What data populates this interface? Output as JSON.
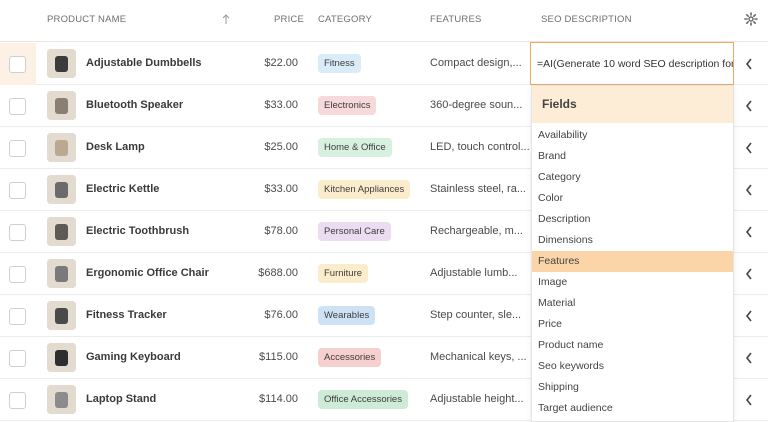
{
  "header": {
    "product_name": "PRODUCT NAME",
    "price": "PRICE",
    "category": "CATEGORY",
    "features": "FEATURES",
    "seo": "SEO DESCRIPTION",
    "sort_icon": "arrow-up-icon",
    "settings_icon": "gear-icon"
  },
  "rows": [
    {
      "name": "Adjustable Dumbbells",
      "price": "$22.00",
      "category": "Fitness",
      "cat_bg": "#d9ecf7",
      "features": "Compact design,..."
    },
    {
      "name": "Bluetooth Speaker",
      "price": "$33.00",
      "category": "Electronics",
      "cat_bg": "#f8d9d9",
      "features": "360-degree soun..."
    },
    {
      "name": "Desk Lamp",
      "price": "$25.00",
      "category": "Home & Office",
      "cat_bg": "#d8f0e0",
      "features": "LED, touch control..."
    },
    {
      "name": "Electric Kettle",
      "price": "$33.00",
      "category": "Kitchen Appliances",
      "cat_bg": "#fbeccc",
      "features": "Stainless steel, ra..."
    },
    {
      "name": "Electric Toothbrush",
      "price": "$78.00",
      "category": "Personal Care",
      "cat_bg": "#ebdcf2",
      "features": "Rechargeable, m..."
    },
    {
      "name": "Ergonomic Office Chair",
      "price": "$688.00",
      "category": "Furniture",
      "cat_bg": "#fbeccc",
      "features": "Adjustable lumb..."
    },
    {
      "name": "Fitness Tracker",
      "price": "$76.00",
      "category": "Wearables",
      "cat_bg": "#cde3f5",
      "features": "Step counter, sle..."
    },
    {
      "name": "Gaming Keyboard",
      "price": "$115.00",
      "category": "Accessories",
      "cat_bg": "#f6cfcf",
      "features": "Mechanical keys, ..."
    },
    {
      "name": "Laptop Stand",
      "price": "$114.00",
      "category": "Office Accessories",
      "cat_bg": "#cdebd6",
      "features": "Adjustable height..."
    }
  ],
  "seo_input": {
    "value": "=AI(Generate 10 word SEO description for"
  },
  "dropdown": {
    "title": "Fields",
    "active": "Features",
    "items": [
      "Availability",
      "Brand",
      "Category",
      "Color",
      "Description",
      "Dimensions",
      "Features",
      "Image",
      "Material",
      "Price",
      "Product name",
      "Seo keywords",
      "Shipping",
      "Target audience"
    ]
  },
  "colors": {
    "accent_border": "#f0a860",
    "dropdown_header": "#fdecd6",
    "active_item": "#fbd4a8",
    "selected_cell": "#fdf1e6"
  }
}
